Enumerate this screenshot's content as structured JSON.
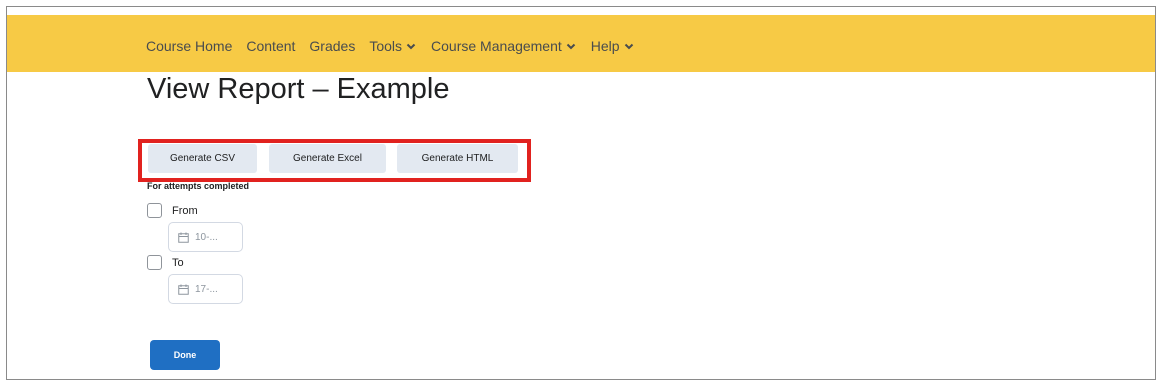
{
  "nav": {
    "items": [
      {
        "label": "Course Home",
        "has_dropdown": false
      },
      {
        "label": "Content",
        "has_dropdown": false
      },
      {
        "label": "Grades",
        "has_dropdown": false
      },
      {
        "label": "Tools",
        "has_dropdown": true
      },
      {
        "label": "Course Management",
        "has_dropdown": true
      },
      {
        "label": "Help",
        "has_dropdown": true
      }
    ],
    "background_color": "#f7ca45"
  },
  "page": {
    "title": "View Report – Example"
  },
  "buttons": {
    "generate_csv": "Generate CSV",
    "generate_excel": "Generate Excel",
    "generate_html": "Generate HTML",
    "highlight_color": "#e1221f"
  },
  "filter": {
    "label": "For attempts completed",
    "from": {
      "label": "From",
      "date_value": "10-...",
      "icon": "calendar-icon",
      "checked": false
    },
    "to": {
      "label": "To",
      "date_value": "17-...",
      "icon": "calendar-icon",
      "checked": false
    }
  },
  "done_button": {
    "label": "Done",
    "color": "#1f6fc3"
  }
}
